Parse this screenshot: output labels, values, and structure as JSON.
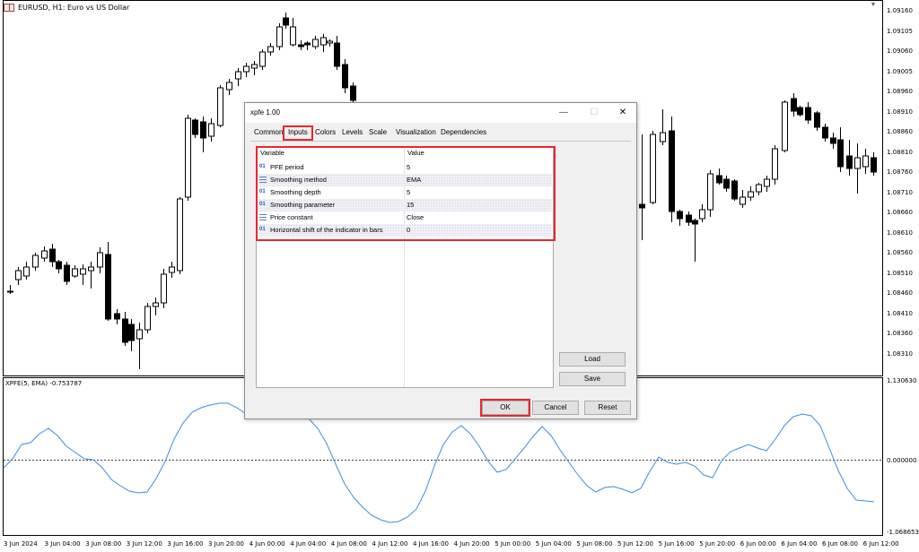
{
  "chart": {
    "symbol_title": "EURUSD, H1:  Euro vs US Dollar",
    "indicator_title": "XPFE(5, EMA) -0.753787",
    "price_labels": [
      "1.09160",
      "1.09105",
      "1.09060",
      "1.09005",
      "1.08960",
      "1.08910",
      "1.08860",
      "1.08810",
      "1.08760",
      "1.08710",
      "1.08660",
      "1.08610",
      "1.08560",
      "1.08510",
      "1.08460",
      "1.08410",
      "1.08360",
      "1.08310"
    ],
    "indicator_labels": [
      "1.130630",
      "0.000000",
      "-1.068653"
    ],
    "time_labels": [
      "3 Jun 2024",
      "3 Jun 04:00",
      "3 Jun 08:00",
      "3 Jun 12:00",
      "3 Jun 16:00",
      "3 Jun 20:00",
      "4 Jun 00:00",
      "4 Jun 04:00",
      "4 Jun 08:00",
      "4 Jun 12:00",
      "4 Jun 16:00",
      "4 Jun 20:00",
      "5 Jun 00:00",
      "5 Jun 04:00",
      "5 Jun 08:00",
      "5 Jun 12:00",
      "5 Jun 16:00",
      "5 Jun 20:00",
      "6 Jun 00:00",
      "6 Jun 04:00",
      "6 Jun 08:00",
      "6 Jun 12:00"
    ],
    "dropdown_glyph": "▼"
  },
  "dialog": {
    "title": "xpfe 1.00",
    "window_buttons": {
      "minimize": "—",
      "maximize": "☐",
      "close": "✕"
    },
    "tabs": [
      "Common",
      "Inputs",
      "Colors",
      "Levels",
      "Scale",
      "Visualization",
      "Dependencies"
    ],
    "active_tab": "Inputs",
    "table": {
      "headers": {
        "variable": "Variable",
        "value": "Value"
      },
      "rows": [
        {
          "icon": "01",
          "name": "PFE period",
          "value": "5"
        },
        {
          "icon": "list",
          "name": "Smoothing method",
          "value": "EMA"
        },
        {
          "icon": "01",
          "name": "Smoothing depth",
          "value": "5"
        },
        {
          "icon": "01",
          "name": "Smoothing parameter",
          "value": "15"
        },
        {
          "icon": "list",
          "name": "Price constant",
          "value": "Close"
        },
        {
          "icon": "01",
          "name": "Horizontal shift of the indicator in bars",
          "value": "0"
        }
      ]
    },
    "buttons": {
      "load": "Load",
      "save": "Save",
      "ok": "OK",
      "cancel": "Cancel",
      "reset": "Reset"
    }
  },
  "colors": {
    "highlight": "#e8282d",
    "indicator_line": "#3a8ee0",
    "candle": "#000000"
  }
}
